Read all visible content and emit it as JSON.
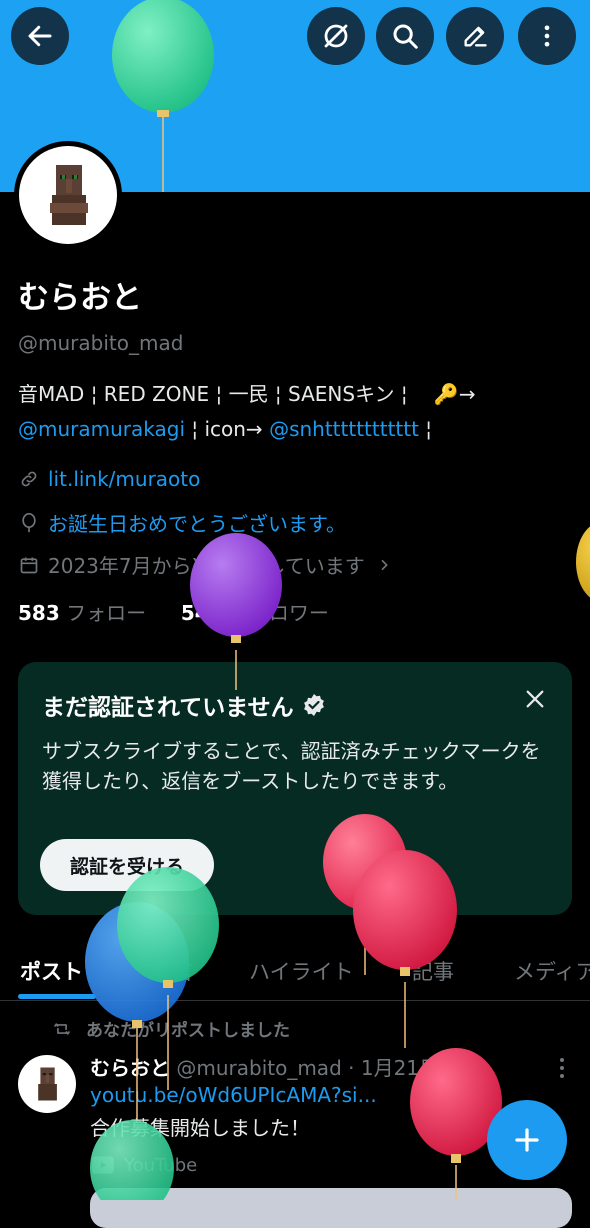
{
  "colors": {
    "banner": "#1da1f2",
    "accent": "#1d9bf0",
    "card_bg": "#062b22"
  },
  "header": {
    "back_icon": "arrow-left-icon",
    "grok_icon": "grok-slash-circle-icon",
    "search_icon": "search-icon",
    "compose_icon": "pencil-icon",
    "more_icon": "more-vertical-icon"
  },
  "profile": {
    "name": "むらおと",
    "handle": "@murabito_mad",
    "bio_line1": "音MAD ¦ RED ZONE ¦ 一民 ¦ SAENSキン ¦ 　🔑→",
    "bio_mention1": "@muramurakagi",
    "bio_sep": " ¦ icon→ ",
    "bio_mention2": "@snhtttttttttttt",
    "bio_end": " ¦",
    "website": "lit.link/muraoto",
    "birthday": "お誕生日おめでとうございます。",
    "joined": "2023年7月からXを利用しています",
    "following_count": "583",
    "following_label": "フォロー",
    "followers_count": "546",
    "followers_label": "フォロワー"
  },
  "verify": {
    "title": "まだ認証されていません",
    "description": "サブスクライブすることで、認証済みチェックマークを獲得したり、返信をブーストしたりできます。",
    "button": "認証を受ける"
  },
  "tabs": [
    "ポスト",
    "返信",
    "ハイライト",
    "記事",
    "メディア"
  ],
  "post": {
    "repost_label": "あなたがリポストしました",
    "author_name": "むらおと",
    "author_handle": "@murabito_mad",
    "date": "1月21日",
    "link": "youtu.be/oWd6UPIcAMA?si...",
    "text": "合作募集開始しました！",
    "source": "YouTube"
  },
  "fab": {
    "icon": "plus-icon"
  }
}
